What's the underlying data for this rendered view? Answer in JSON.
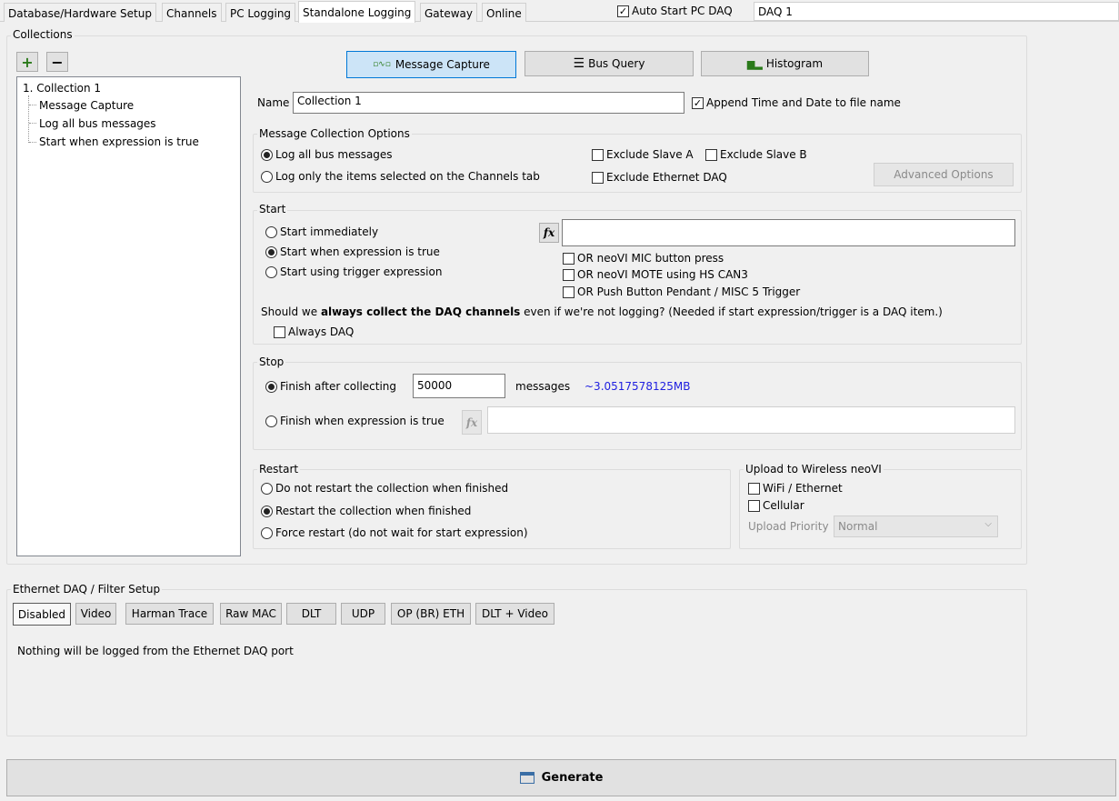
{
  "tabs": [
    {
      "label": "Database/Hardware Setup"
    },
    {
      "label": "Channels"
    },
    {
      "label": "PC Logging"
    },
    {
      "label": "Standalone Logging",
      "active": true
    },
    {
      "label": "Gateway"
    },
    {
      "label": "Online"
    }
  ],
  "header": {
    "auto_start_label": "Auto Start PC DAQ",
    "auto_start_checked": true,
    "daq_name": "DAQ 1"
  },
  "collections": {
    "title": "Collections",
    "add_label": "+",
    "remove_label": "−",
    "tree": {
      "root": "1. Collection 1",
      "children": [
        "Message Capture",
        "Log all bus messages",
        "Start when expression is true"
      ]
    }
  },
  "mode_buttons": {
    "message_capture": "Message Capture",
    "bus_query": "Bus Query",
    "histogram": "Histogram",
    "active": "message_capture"
  },
  "name": {
    "label": "Name",
    "value": "Collection 1",
    "append_label": "Append Time and Date to file name",
    "append_checked": true
  },
  "message_options": {
    "title": "Message Collection Options",
    "log_all": "Log all bus messages",
    "log_selected": "Log only the items selected on the Channels tab",
    "selected": "log_all",
    "exclude_slave_a": "Exclude Slave A",
    "exclude_slave_b": "Exclude Slave B",
    "exclude_ethernet": "Exclude Ethernet DAQ",
    "advanced": "Advanced Options"
  },
  "start": {
    "title": "Start",
    "immediately": "Start immediately",
    "expression": "Start when expression is true",
    "trigger": "Start using trigger expression",
    "selected": "expression",
    "fx": "fx",
    "expression_value": "",
    "mic": "OR neoVI MIC button press",
    "mote": "OR neoVI MOTE using HS CAN3",
    "pendant": "OR Push Button Pendant / MISC 5 Trigger",
    "daq_note_pre": "Should we ",
    "daq_note_bold": "always collect the DAQ channels",
    "daq_note_post": " even if we're not logging? (Needed if start expression/trigger is a DAQ item.)",
    "always_daq": "Always DAQ"
  },
  "stop": {
    "title": "Stop",
    "finish_after": "Finish after collecting",
    "count": "50000",
    "unit": "messages",
    "size": "~3.0517578125MB",
    "finish_expr": "Finish when expression is true",
    "fx": "fx",
    "expr_value": "",
    "selected": "finish_after"
  },
  "restart": {
    "title": "Restart",
    "no_restart": "Do not restart the collection when finished",
    "restart": "Restart the collection when finished",
    "force": "Force restart (do not wait for start expression)",
    "selected": "restart"
  },
  "upload": {
    "title": "Upload to Wireless neoVI",
    "wifi": "WiFi / Ethernet",
    "cellular": "Cellular",
    "priority_label": "Upload Priority",
    "priority_value": "Normal"
  },
  "ethernet": {
    "title": "Ethernet DAQ / Filter Setup",
    "buttons": [
      "Disabled",
      "Video",
      "Harman Trace",
      "Raw MAC",
      "DLT",
      "UDP",
      "OP (BR) ETH",
      "DLT + Video"
    ],
    "active": "Disabled",
    "message": "Nothing will be logged from the Ethernet DAQ port"
  },
  "generate": {
    "label": "Generate"
  },
  "colors": {
    "accent": "#0078d7",
    "link_blue": "#0000ff",
    "active_btn": "#cce4f7"
  }
}
